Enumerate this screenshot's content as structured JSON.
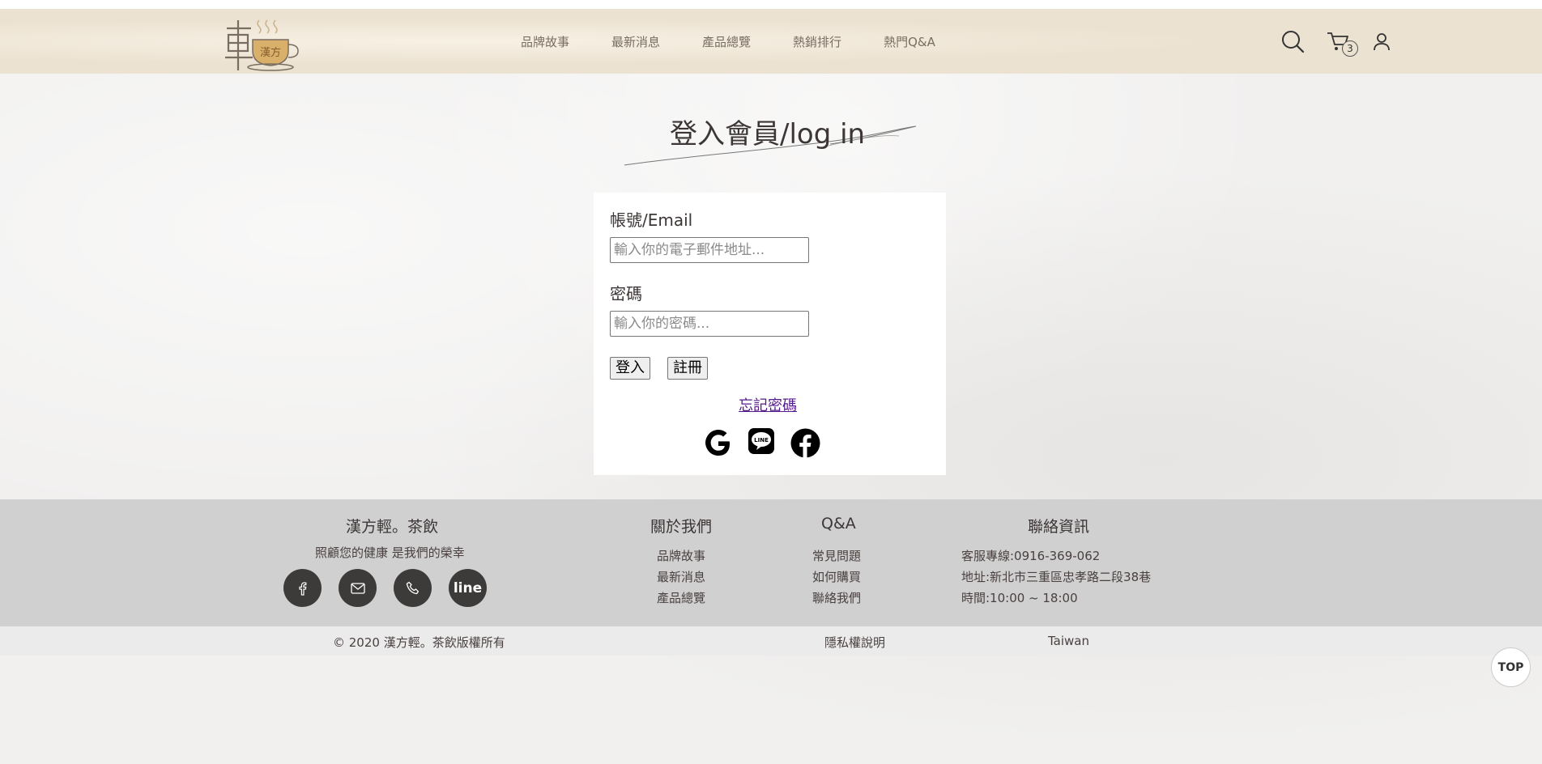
{
  "header": {
    "logo_text": "漢方",
    "nav": [
      "品牌故事",
      "最新消息",
      "產品總覽",
      "熱銷排行",
      "熱門Q&A"
    ],
    "cart_count": "3"
  },
  "login": {
    "title": "登入會員/log in",
    "account_label": "帳號/Email",
    "account_placeholder": "輸入你的電子郵件地址...",
    "password_label": "密碼",
    "password_placeholder": "輸入你的密碼...",
    "login_button": "登入",
    "register_button": "註冊",
    "forgot_link": "忘記密碼",
    "social_icons": [
      "google-icon",
      "line-icon",
      "facebook-icon"
    ]
  },
  "footer": {
    "brand": {
      "title": "漢方輕。茶飲",
      "slogan": "照顧您的健康 是我們的榮幸",
      "circle_icons": [
        "facebook-icon",
        "mail-icon",
        "phone-icon",
        "line"
      ]
    },
    "about": {
      "title": "關於我們",
      "links": [
        "品牌故事",
        "最新消息",
        "產品總覽"
      ]
    },
    "qa": {
      "title": "Q&A",
      "links": [
        "常見問題",
        "如何購買",
        "聯絡我們"
      ]
    },
    "contact": {
      "title": "聯絡資訊",
      "lines": [
        "客服專線:0916-369-062",
        "地址:新北市三重區忠孝路二段38巷",
        "時間:10:00 ~ 18:00"
      ]
    }
  },
  "bottom_bar": {
    "copyright": "© 2020 漢方輕。茶飲版權所有",
    "privacy": "隱私權說明",
    "region": "Taiwan"
  },
  "top_button": "TOP",
  "colors": {
    "header_bg": "#ece2d2",
    "footer_bg": "#d0d0d0",
    "bottom_bg": "#ebebeb",
    "circle_bg": "#3d3a3a",
    "text": "#4a4040"
  }
}
